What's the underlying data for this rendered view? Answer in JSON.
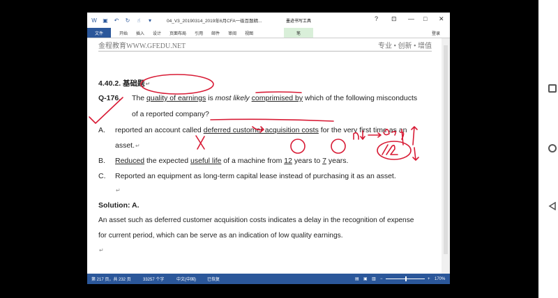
{
  "titlebar": {
    "doc_title": "04_V3_20190314_2019年6月CFA一级百题精...",
    "context_tab": "墨迹书写工具",
    "help": "?",
    "minimize": "—",
    "restore": "□",
    "close": "✕"
  },
  "ribbon": {
    "file": "文件",
    "tabs": [
      "开始",
      "插入",
      "设计",
      "页面布局",
      "引用",
      "邮件",
      "审阅",
      "视图"
    ],
    "pen": "笔",
    "login": "登录"
  },
  "header": {
    "left": "金程教育WWW.GFEDU.NET",
    "right": "专业 • 创新 • 增值"
  },
  "doc": {
    "section": "4.40.2.",
    "section_title": "基础题",
    "q_label": "Q-176.",
    "q_text_1a": "The ",
    "q_text_1b": "quality of earnings",
    "q_text_1c": " is ",
    "q_text_1d": "most likely",
    "q_text_1e": " ",
    "q_text_1f": "comprimised by",
    "q_text_1g": " which of the following misconducts",
    "q_text_2": "of a reported company?",
    "opt_a_label": "A.",
    "opt_a_1a": "reported an account called ",
    "opt_a_1b": "deferred customer acquisition costs",
    "opt_a_1c": " for the very first time as an",
    "opt_a_2": "asset.",
    "opt_b_label": "B.",
    "opt_b_a": "Reduced",
    "opt_b_b": " the expected ",
    "opt_b_c": "useful life",
    "opt_b_d": " of a machine from ",
    "opt_b_e": "12",
    "opt_b_f": " years to ",
    "opt_b_g": "7",
    "opt_b_h": " years.",
    "opt_c_label": "C.",
    "opt_c_text": "Reported an equipment as long-term capital lease instead of purchasing it as an asset.",
    "solution": "Solution: A.",
    "sol_1": "An asset such as deferred customer acquisition costs indicates a delay in the recognition of expense",
    "sol_2": "for current period, which can be serve as an indication of low quality earnings."
  },
  "status": {
    "page": "第 217 页，共 232 页",
    "words": "33257 个字",
    "lang": "中文(中国)",
    "recovered": "已恢复",
    "zoom": "170%"
  },
  "colors": {
    "word_blue": "#2b579a",
    "ink_red": "#d81b35"
  }
}
